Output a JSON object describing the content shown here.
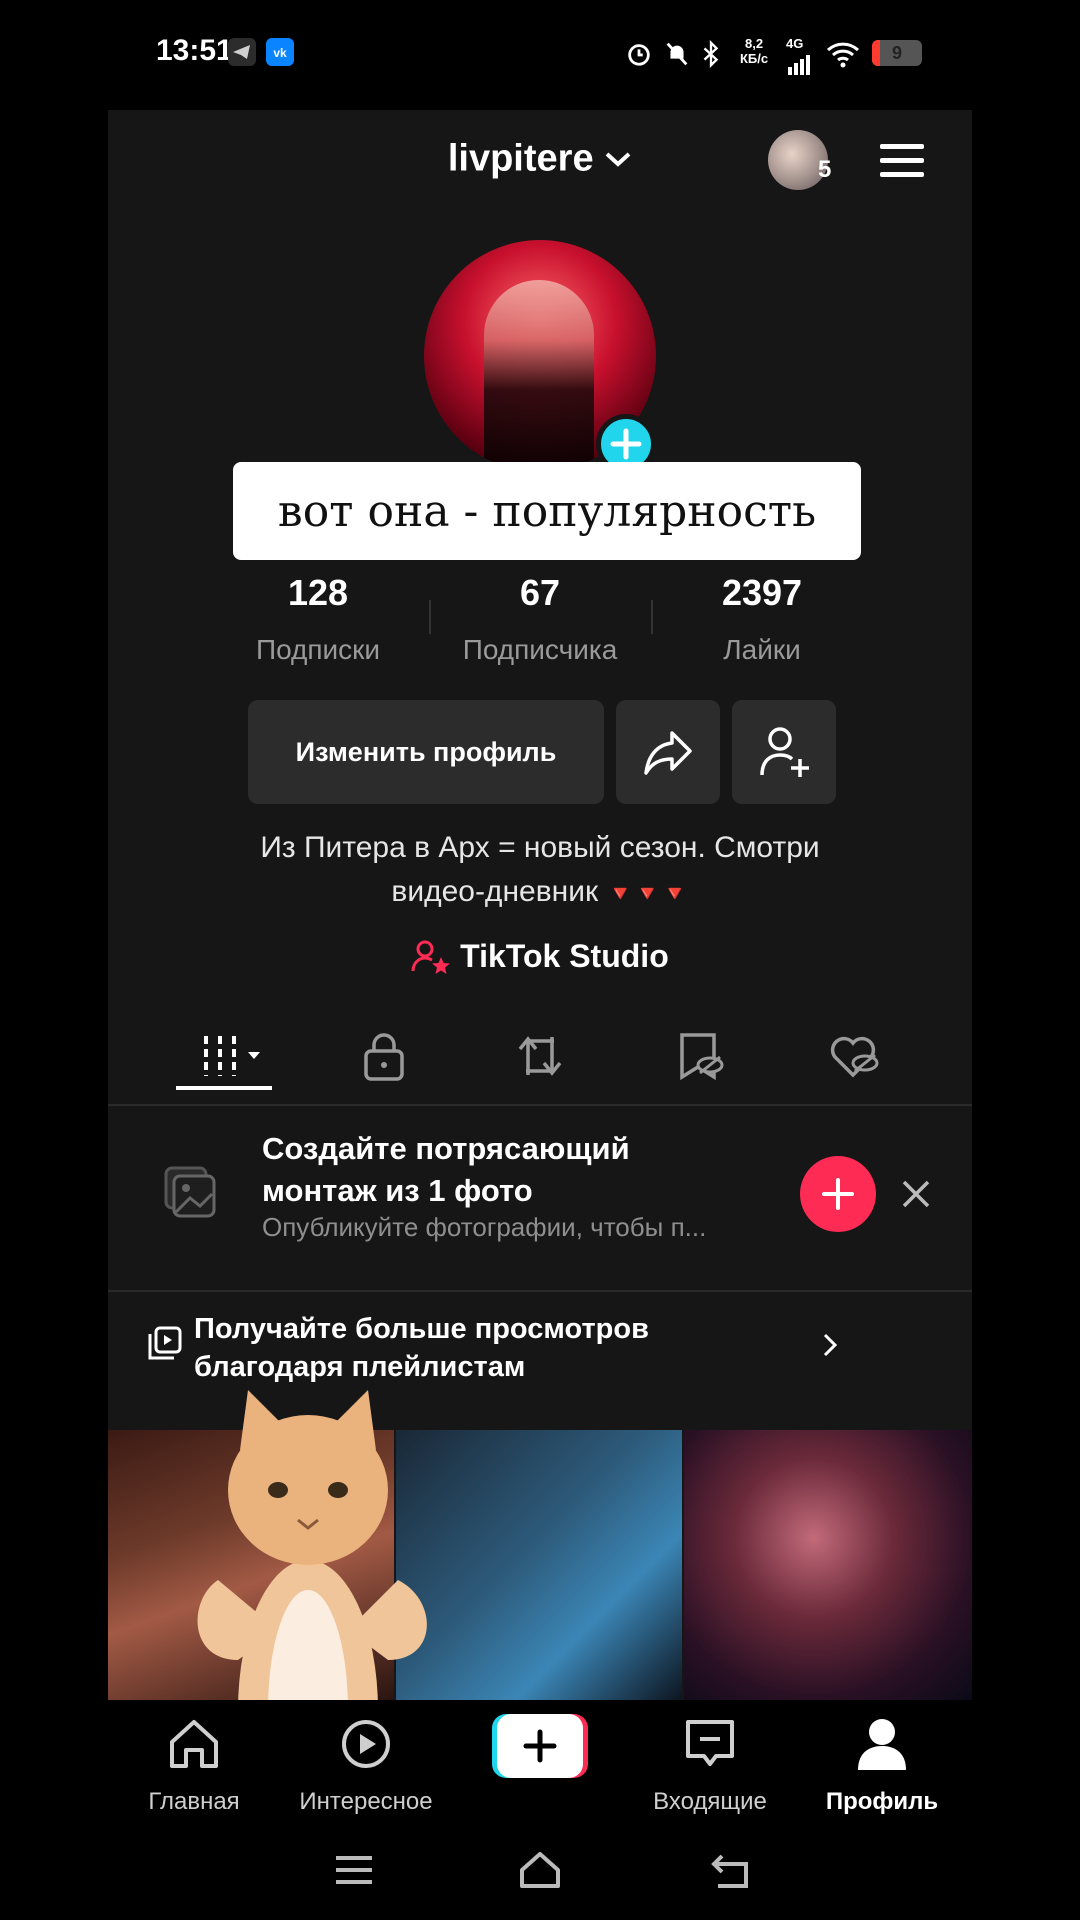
{
  "status_bar": {
    "time": "13:51",
    "network_speed_value": "8,2",
    "network_speed_unit": "КБ/с",
    "network_type": "4G",
    "battery_level": "9"
  },
  "header": {
    "username": "livpitere",
    "account_switch_count": "5"
  },
  "caption_overlay": "вот она - популярность",
  "stats": [
    {
      "value": "128",
      "label": "Подписки"
    },
    {
      "value": "67",
      "label": "Подписчика"
    },
    {
      "value": "2397",
      "label": "Лайки"
    }
  ],
  "actions": {
    "edit_profile_label": "Изменить профиль"
  },
  "bio": {
    "line1": "Из Питера в Арх = новый сезон. Смотри",
    "line2": "видео-дневник",
    "triangles": "🔻🔻🔻"
  },
  "studio_link": "TikTok Studio",
  "promo": {
    "title": "Создайте потрясающий монтаж из 1 фото",
    "subtitle": "Опубликуйте фотографии, чтобы п..."
  },
  "playlist_banner": {
    "text": "Получайте больше просмотров благодаря плейлистам"
  },
  "bottom_nav": [
    {
      "label": "Главная"
    },
    {
      "label": "Интересное"
    },
    {
      "label": ""
    },
    {
      "label": "Входящие"
    },
    {
      "label": "Профиль"
    }
  ],
  "colors": {
    "accent_pink": "#fe2c55",
    "accent_cyan": "#20d5ec",
    "background": "#161616"
  }
}
